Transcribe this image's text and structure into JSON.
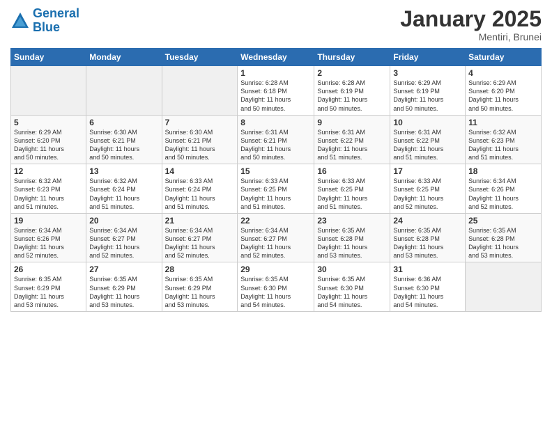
{
  "logo": {
    "line1": "General",
    "line2": "Blue"
  },
  "title": "January 2025",
  "subtitle": "Mentiri, Brunei",
  "weekdays": [
    "Sunday",
    "Monday",
    "Tuesday",
    "Wednesday",
    "Thursday",
    "Friday",
    "Saturday"
  ],
  "weeks": [
    [
      {
        "day": "",
        "info": ""
      },
      {
        "day": "",
        "info": ""
      },
      {
        "day": "",
        "info": ""
      },
      {
        "day": "1",
        "info": "Sunrise: 6:28 AM\nSunset: 6:18 PM\nDaylight: 11 hours\nand 50 minutes."
      },
      {
        "day": "2",
        "info": "Sunrise: 6:28 AM\nSunset: 6:19 PM\nDaylight: 11 hours\nand 50 minutes."
      },
      {
        "day": "3",
        "info": "Sunrise: 6:29 AM\nSunset: 6:19 PM\nDaylight: 11 hours\nand 50 minutes."
      },
      {
        "day": "4",
        "info": "Sunrise: 6:29 AM\nSunset: 6:20 PM\nDaylight: 11 hours\nand 50 minutes."
      }
    ],
    [
      {
        "day": "5",
        "info": "Sunrise: 6:29 AM\nSunset: 6:20 PM\nDaylight: 11 hours\nand 50 minutes."
      },
      {
        "day": "6",
        "info": "Sunrise: 6:30 AM\nSunset: 6:21 PM\nDaylight: 11 hours\nand 50 minutes."
      },
      {
        "day": "7",
        "info": "Sunrise: 6:30 AM\nSunset: 6:21 PM\nDaylight: 11 hours\nand 50 minutes."
      },
      {
        "day": "8",
        "info": "Sunrise: 6:31 AM\nSunset: 6:21 PM\nDaylight: 11 hours\nand 50 minutes."
      },
      {
        "day": "9",
        "info": "Sunrise: 6:31 AM\nSunset: 6:22 PM\nDaylight: 11 hours\nand 51 minutes."
      },
      {
        "day": "10",
        "info": "Sunrise: 6:31 AM\nSunset: 6:22 PM\nDaylight: 11 hours\nand 51 minutes."
      },
      {
        "day": "11",
        "info": "Sunrise: 6:32 AM\nSunset: 6:23 PM\nDaylight: 11 hours\nand 51 minutes."
      }
    ],
    [
      {
        "day": "12",
        "info": "Sunrise: 6:32 AM\nSunset: 6:23 PM\nDaylight: 11 hours\nand 51 minutes."
      },
      {
        "day": "13",
        "info": "Sunrise: 6:32 AM\nSunset: 6:24 PM\nDaylight: 11 hours\nand 51 minutes."
      },
      {
        "day": "14",
        "info": "Sunrise: 6:33 AM\nSunset: 6:24 PM\nDaylight: 11 hours\nand 51 minutes."
      },
      {
        "day": "15",
        "info": "Sunrise: 6:33 AM\nSunset: 6:25 PM\nDaylight: 11 hours\nand 51 minutes."
      },
      {
        "day": "16",
        "info": "Sunrise: 6:33 AM\nSunset: 6:25 PM\nDaylight: 11 hours\nand 51 minutes."
      },
      {
        "day": "17",
        "info": "Sunrise: 6:33 AM\nSunset: 6:25 PM\nDaylight: 11 hours\nand 52 minutes."
      },
      {
        "day": "18",
        "info": "Sunrise: 6:34 AM\nSunset: 6:26 PM\nDaylight: 11 hours\nand 52 minutes."
      }
    ],
    [
      {
        "day": "19",
        "info": "Sunrise: 6:34 AM\nSunset: 6:26 PM\nDaylight: 11 hours\nand 52 minutes."
      },
      {
        "day": "20",
        "info": "Sunrise: 6:34 AM\nSunset: 6:27 PM\nDaylight: 11 hours\nand 52 minutes."
      },
      {
        "day": "21",
        "info": "Sunrise: 6:34 AM\nSunset: 6:27 PM\nDaylight: 11 hours\nand 52 minutes."
      },
      {
        "day": "22",
        "info": "Sunrise: 6:34 AM\nSunset: 6:27 PM\nDaylight: 11 hours\nand 52 minutes."
      },
      {
        "day": "23",
        "info": "Sunrise: 6:35 AM\nSunset: 6:28 PM\nDaylight: 11 hours\nand 53 minutes."
      },
      {
        "day": "24",
        "info": "Sunrise: 6:35 AM\nSunset: 6:28 PM\nDaylight: 11 hours\nand 53 minutes."
      },
      {
        "day": "25",
        "info": "Sunrise: 6:35 AM\nSunset: 6:28 PM\nDaylight: 11 hours\nand 53 minutes."
      }
    ],
    [
      {
        "day": "26",
        "info": "Sunrise: 6:35 AM\nSunset: 6:29 PM\nDaylight: 11 hours\nand 53 minutes."
      },
      {
        "day": "27",
        "info": "Sunrise: 6:35 AM\nSunset: 6:29 PM\nDaylight: 11 hours\nand 53 minutes."
      },
      {
        "day": "28",
        "info": "Sunrise: 6:35 AM\nSunset: 6:29 PM\nDaylight: 11 hours\nand 53 minutes."
      },
      {
        "day": "29",
        "info": "Sunrise: 6:35 AM\nSunset: 6:30 PM\nDaylight: 11 hours\nand 54 minutes."
      },
      {
        "day": "30",
        "info": "Sunrise: 6:35 AM\nSunset: 6:30 PM\nDaylight: 11 hours\nand 54 minutes."
      },
      {
        "day": "31",
        "info": "Sunrise: 6:36 AM\nSunset: 6:30 PM\nDaylight: 11 hours\nand 54 minutes."
      },
      {
        "day": "",
        "info": ""
      }
    ]
  ]
}
